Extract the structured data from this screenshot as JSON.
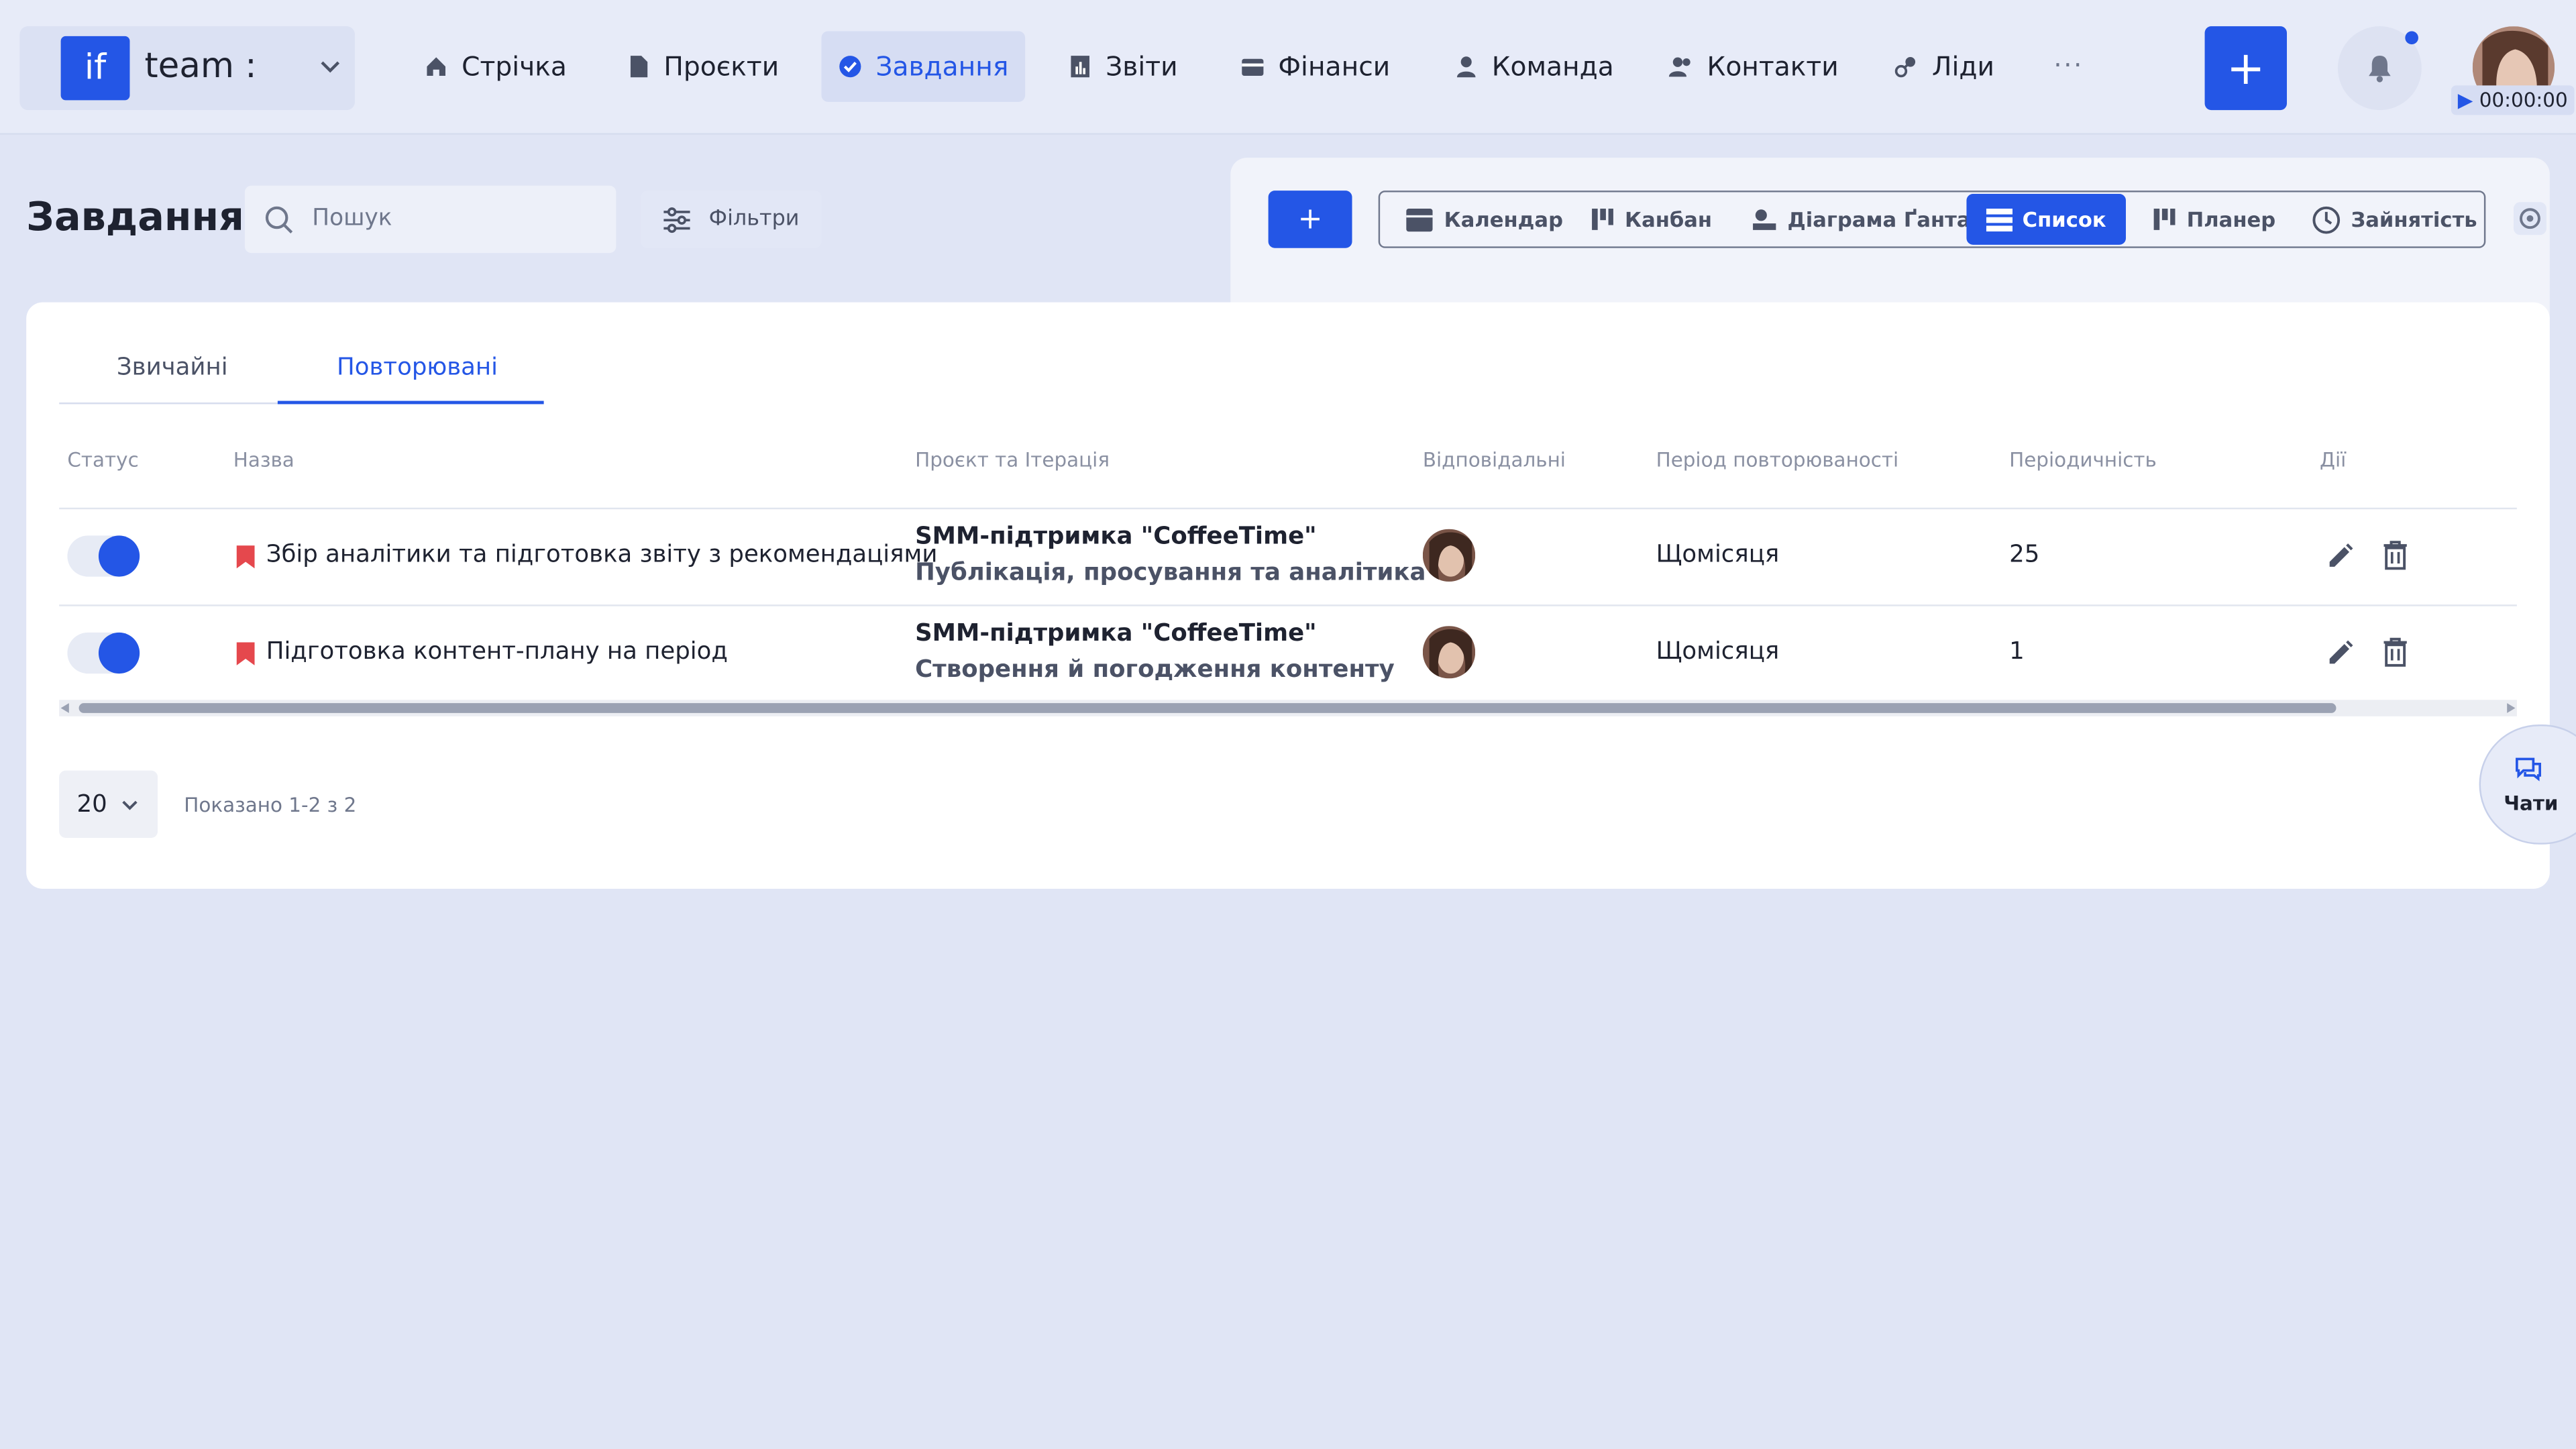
{
  "brand": {
    "logo_text": "if",
    "name": "team :"
  },
  "nav": [
    {
      "label": "Стрічка",
      "icon": "home-icon"
    },
    {
      "label": "Проєкти",
      "icon": "file-icon"
    },
    {
      "label": "Завдання",
      "icon": "check-circle-icon",
      "active": true
    },
    {
      "label": "Звіти",
      "icon": "report-icon"
    },
    {
      "label": "Фінанси",
      "icon": "wallet-icon"
    },
    {
      "label": "Команда",
      "icon": "user-icon"
    },
    {
      "label": "Контакти",
      "icon": "contacts-icon"
    },
    {
      "label": "Ліди",
      "icon": "leads-icon"
    }
  ],
  "nav_more": "···",
  "header": {
    "add_label": "+",
    "timer": "00:00:00",
    "notification_dot": true
  },
  "page": {
    "title": "Завдання",
    "search_placeholder": "Пошук",
    "filters_label": "Фільтри"
  },
  "views": {
    "add_label": "+",
    "items": [
      {
        "label": "Календар",
        "icon": "calendar-icon"
      },
      {
        "label": "Канбан",
        "icon": "kanban-icon"
      },
      {
        "label": "Діаграма Ґанта",
        "icon": "gantt-icon"
      },
      {
        "label": "Список",
        "icon": "list-icon",
        "active": true
      },
      {
        "label": "Планер",
        "icon": "planner-icon"
      },
      {
        "label": "Зайнятість",
        "icon": "clock-icon"
      }
    ]
  },
  "tabs": [
    {
      "label": "Звичайні"
    },
    {
      "label": "Повторювані",
      "active": true
    }
  ],
  "table": {
    "headers": [
      "Статус",
      "Назва",
      "Проєкт та Ітерація",
      "Відповідальні",
      "Період повторюваності",
      "Періодичність",
      "Дії"
    ],
    "rows": [
      {
        "status_on": true,
        "name": "Збір аналітики та підготовка звіту з рекомендаціями",
        "project": "SMM-підтримка \"CoffeeTime\"",
        "iteration": "Публікація, просування та аналітика",
        "period": "Щомісяця",
        "frequency": "25"
      },
      {
        "status_on": true,
        "name": "Підготовка контент-плану на період",
        "project": "SMM-підтримка \"CoffeeTime\"",
        "iteration": "Створення й погодження контенту",
        "period": "Щомісяця",
        "frequency": "1"
      }
    ]
  },
  "pagination": {
    "page_size": "20",
    "info": "Показано 1-2 з 2"
  },
  "chat": {
    "label": "Чати"
  },
  "colors": {
    "accent": "#2456e6",
    "background": "#e0e5f5",
    "flag": "#e5484d"
  }
}
